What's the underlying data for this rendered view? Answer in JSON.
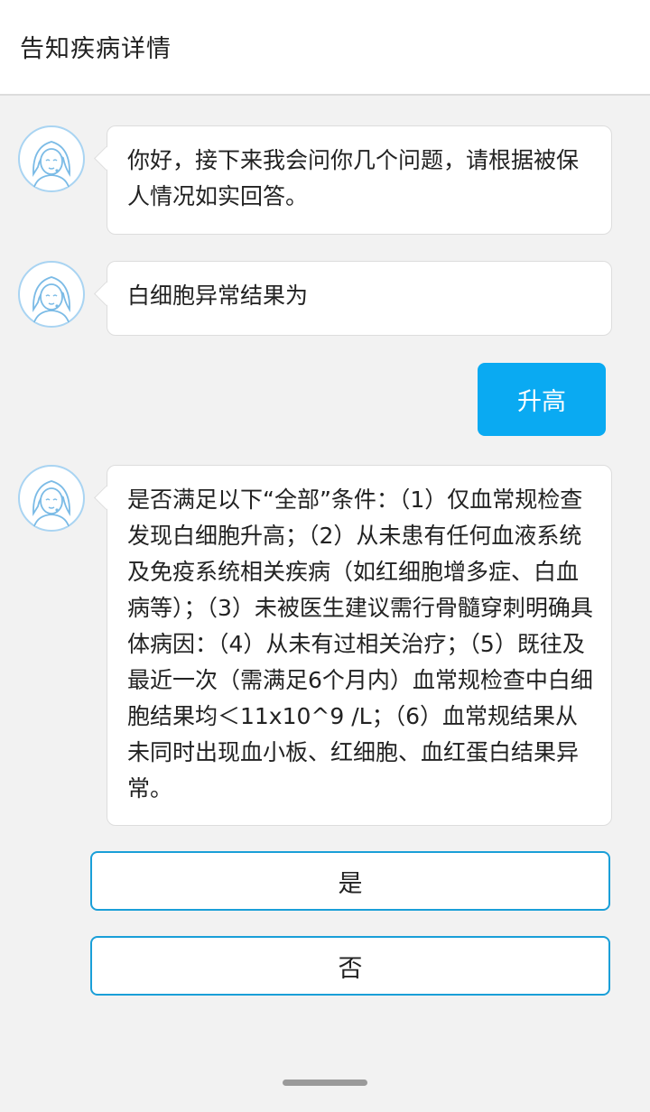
{
  "header": {
    "title": "告知疾病详情"
  },
  "messages": [
    {
      "text": "你好，接下来我会问你几个问题，请根据被保人情况如实回答。"
    },
    {
      "text": "白细胞异常结果为"
    },
    {
      "text": "是否满足以下“全部”条件：（1）仅血常规检查发现白细胞升高；（2）从未患有任何血液系统及免疫系统相关疾病（如红细胞增多症、白血病等）；（3）未被医生建议需行骨髓穿刺明确具体病因：（4）从未有过相关治疗；（5）既往及最近一次（需满足6个月内）血常规检查中白细胞结果均＜11x10^9 /L；（6）血常规结果从未同时出现血小板、红细胞、血红蛋白结果异常。"
    }
  ],
  "user_reply": {
    "text": "升高"
  },
  "options": [
    {
      "label": "是"
    },
    {
      "label": "否"
    }
  ],
  "icons": {
    "avatar": "customer-service-avatar-icon"
  },
  "colors": {
    "accent": "#0aaaf2",
    "option_border": "#1a9fd8",
    "background": "#f2f2f2"
  }
}
